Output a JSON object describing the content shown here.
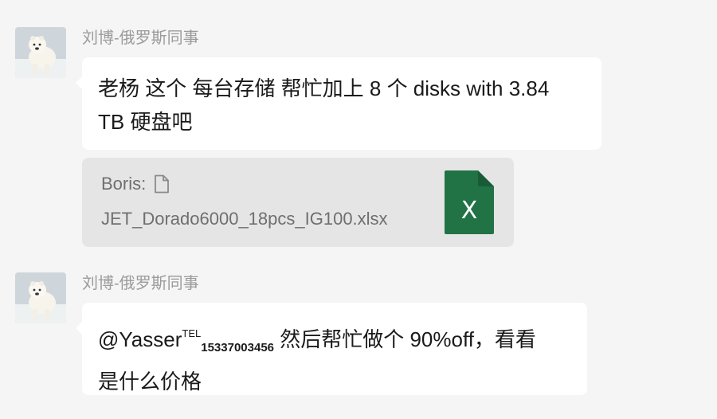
{
  "messages": [
    {
      "sender": "刘博-俄罗斯同事",
      "text_line1": "老杨 这个 每台存储 帮忙加上 8 个 disks with 3.84",
      "text_line2": "TB 硬盘吧"
    },
    {
      "file": {
        "from_label": "Boris:",
        "name": "JET_Dorado6000_18pcs_IG100.xlsx",
        "icon_letter": "X",
        "icon_color": "#217346"
      }
    },
    {
      "sender": "刘博-俄罗斯同事",
      "mention": "@Yasser",
      "tel_tag": "TEL",
      "tel_number": "15337003456",
      "text_rest": "然后帮忙做个 90%off，看看",
      "text_line2": "是什么价格"
    }
  ],
  "icons": {
    "avatar": "polar-bear-avatar",
    "file_doc": "document-icon",
    "excel": "excel-file-icon"
  }
}
